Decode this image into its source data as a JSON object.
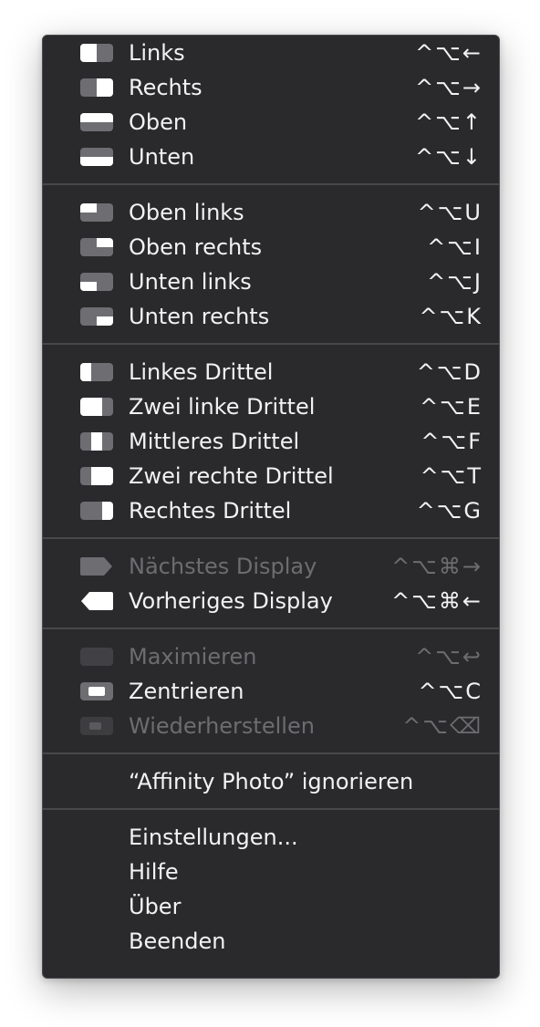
{
  "colors": {
    "menu_bg": "#2a2a2d",
    "text": "#f2f2f2",
    "disabled_text": "#6d6d70",
    "separator": "#48484b",
    "icon_light": "#ffffff",
    "icon_dark": "#6e6e72"
  },
  "groups": [
    {
      "items": [
        {
          "icon": "left-half-icon",
          "label": "Links",
          "shortcut": "^⌥←",
          "enabled": true
        },
        {
          "icon": "right-half-icon",
          "label": "Rechts",
          "shortcut": "^⌥→",
          "enabled": true
        },
        {
          "icon": "top-half-icon",
          "label": "Oben",
          "shortcut": "^⌥↑",
          "enabled": true
        },
        {
          "icon": "bottom-half-icon",
          "label": "Unten",
          "shortcut": "^⌥↓",
          "enabled": true
        }
      ]
    },
    {
      "items": [
        {
          "icon": "top-left-quarter-icon",
          "label": "Oben links",
          "shortcut": "^⌥U",
          "enabled": true
        },
        {
          "icon": "top-right-quarter-icon",
          "label": "Oben rechts",
          "shortcut": "^⌥I",
          "enabled": true
        },
        {
          "icon": "bottom-left-quarter-icon",
          "label": "Unten links",
          "shortcut": "^⌥J",
          "enabled": true
        },
        {
          "icon": "bottom-right-quarter-icon",
          "label": "Unten rechts",
          "shortcut": "^⌥K",
          "enabled": true
        }
      ]
    },
    {
      "items": [
        {
          "icon": "left-third-icon",
          "label": "Linkes Drittel",
          "shortcut": "^⌥D",
          "enabled": true
        },
        {
          "icon": "left-two-thirds-icon",
          "label": "Zwei linke Drittel",
          "shortcut": "^⌥E",
          "enabled": true
        },
        {
          "icon": "center-third-icon",
          "label": "Mittleres Drittel",
          "shortcut": "^⌥F",
          "enabled": true
        },
        {
          "icon": "right-two-thirds-icon",
          "label": "Zwei rechte Drittel",
          "shortcut": "^⌥T",
          "enabled": true
        },
        {
          "icon": "right-third-icon",
          "label": "Rechtes Drittel",
          "shortcut": "^⌥G",
          "enabled": true
        }
      ]
    },
    {
      "items": [
        {
          "icon": "next-display-icon",
          "label": "Nächstes Display",
          "shortcut": "^⌥⌘→",
          "enabled": false
        },
        {
          "icon": "previous-display-icon",
          "label": "Vorheriges Display",
          "shortcut": "^⌥⌘←",
          "enabled": true
        }
      ]
    },
    {
      "items": [
        {
          "icon": "maximize-icon",
          "label": "Maximieren",
          "shortcut": "^⌥↩",
          "enabled": false
        },
        {
          "icon": "center-icon",
          "label": "Zentrieren",
          "shortcut": "^⌥C",
          "enabled": true
        },
        {
          "icon": "restore-icon",
          "label": "Wiederherstellen",
          "shortcut": "^⌥⌫",
          "enabled": false
        }
      ]
    },
    {
      "items": [
        {
          "icon": "",
          "label": "“Affinity Photo” ignorieren",
          "shortcut": "",
          "enabled": true
        }
      ]
    },
    {
      "items": [
        {
          "icon": "",
          "label": "Einstellungen...",
          "shortcut": "",
          "enabled": true
        },
        {
          "icon": "",
          "label": "Hilfe",
          "shortcut": "",
          "enabled": true
        },
        {
          "icon": "",
          "label": "Über",
          "shortcut": "",
          "enabled": true
        },
        {
          "icon": "",
          "label": "Beenden",
          "shortcut": "",
          "enabled": true
        }
      ]
    }
  ]
}
